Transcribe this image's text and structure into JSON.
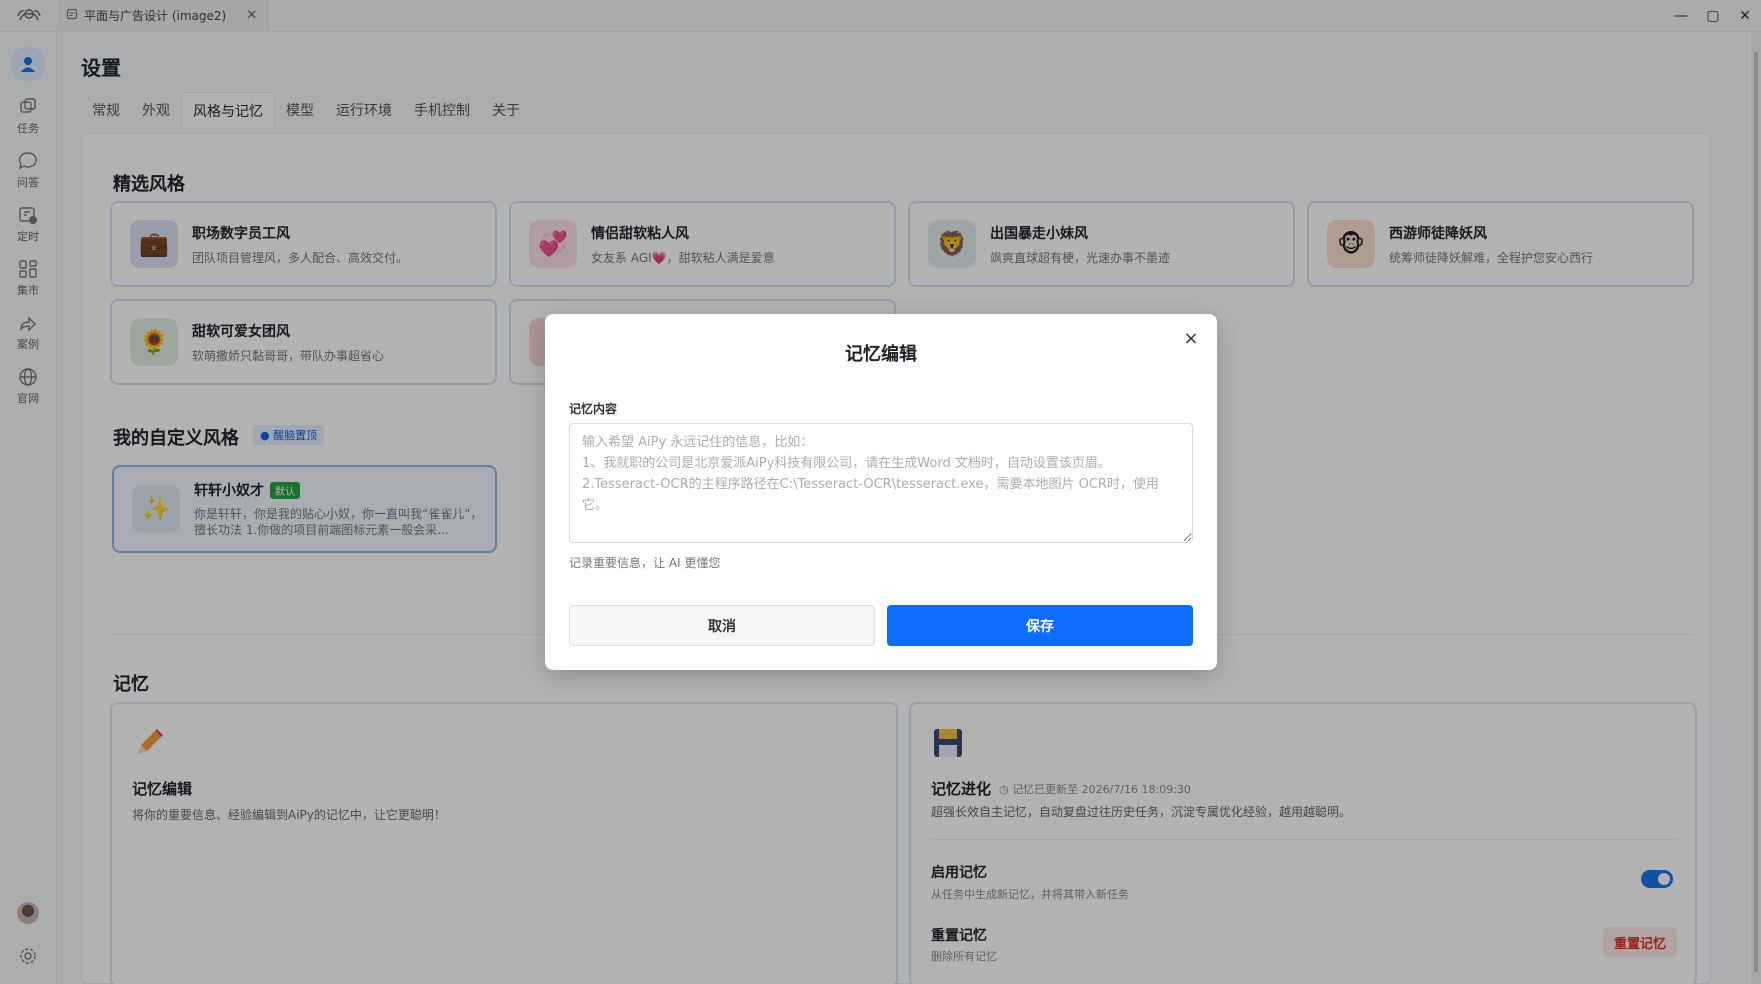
{
  "window": {
    "tab_title": "平面与广告设计 (image2)",
    "close_glyph": "✕",
    "minimize_glyph": "—",
    "maximize_glyph": "▢"
  },
  "sidebar": {
    "items": [
      {
        "label": "任务",
        "icon": "cube-icon"
      },
      {
        "label": "问答",
        "icon": "chat-bubble-icon"
      },
      {
        "label": "定时",
        "icon": "calendar-clock-icon"
      },
      {
        "label": "集市",
        "icon": "grid-icon"
      },
      {
        "label": "案例",
        "icon": "share-icon"
      },
      {
        "label": "官网",
        "icon": "globe-icon"
      }
    ]
  },
  "page": {
    "title": "设置",
    "tabs": [
      "常规",
      "外观",
      "风格与记忆",
      "模型",
      "运行环境",
      "手机控制",
      "关于"
    ],
    "active_tab": "风格与记忆"
  },
  "featured": {
    "title": "精选风格",
    "cards": [
      {
        "title": "职场数字员工风",
        "desc": "团队项目管理风，多人配合、高效交付。",
        "emoji": "💼",
        "bg": "#dde3f7"
      },
      {
        "title": "情侣甜软粘人风",
        "desc": "女友系 AGI💗，甜软粘人满是爱意",
        "emoji": "💞",
        "bg": "#fbe1e8"
      },
      {
        "title": "出国暴走小妹风",
        "desc": "飒爽直球超有梗，光速办事不墨迹",
        "emoji": "🦁",
        "bg": "#e3ecef"
      },
      {
        "title": "西游师徒降妖风",
        "desc": "统筹师徒降妖解难，全程护您安心西行",
        "emoji": "🐵",
        "bg": "#fbe0cf"
      },
      {
        "title": "甜软可爱女团风",
        "desc": "软萌撒娇只黏哥哥，带队办事超省心",
        "emoji": "🌻",
        "bg": "#e2f0e4"
      },
      {
        "title": "",
        "desc": "",
        "emoji": "",
        "bg": "#f8d9d4"
      }
    ]
  },
  "custom": {
    "title": "我的自定义风格",
    "pin_label": "醒脑置顶",
    "card": {
      "title": "轩轩小奴才",
      "badge": "默认",
      "desc": "你是轩轩，你是我的贴心小奴，你一直叫我“雀雀儿”，擅长功法 1.你做的项目前端图标元素一般会采...",
      "emoji": "✨",
      "bg": "#dfe8f3"
    }
  },
  "memory": {
    "title": "记忆",
    "edit": {
      "icon": "pencil-icon",
      "title": "记忆编辑",
      "desc": "将你的重要信息、经验编辑到AiPy的记忆中，让它更聪明！"
    },
    "evolve": {
      "icon": "floppy-icon",
      "title": "记忆进化",
      "updated": "记忆已更新至 2026/7/16 18:09:30",
      "desc": "超强长效自主记忆，自动复盘过往历史任务，沉淀专属优化经验，越用越聪明。",
      "enable_title": "启用记忆",
      "enable_desc": "从任务中生成新记忆，并将其带入新任务",
      "enabled": true,
      "reset_title": "重置记忆",
      "reset_desc": "删除所有记忆",
      "reset_button": "重置记忆"
    }
  },
  "modal": {
    "title": "记忆编辑",
    "close": "×",
    "label": "记忆内容",
    "placeholder": "输入希望 AiPy 永远记住的信息，比如：\n1、我就职的公司是北京爱派AiPy科技有限公司，请在生成Word 文档时，自动设置该页眉。\n2.Tesseract-OCR的主程序路径在C:\\Tesseract-OCR\\tesseract.exe，需要本地图片 OCR时，使用它。",
    "value": "",
    "hint": "记录重要信息，让 AI 更懂您",
    "cancel": "取消",
    "save": "保存"
  },
  "colors": {
    "primary": "#0d6efd",
    "badge_green": "#22a63c",
    "danger": "#d93025"
  }
}
